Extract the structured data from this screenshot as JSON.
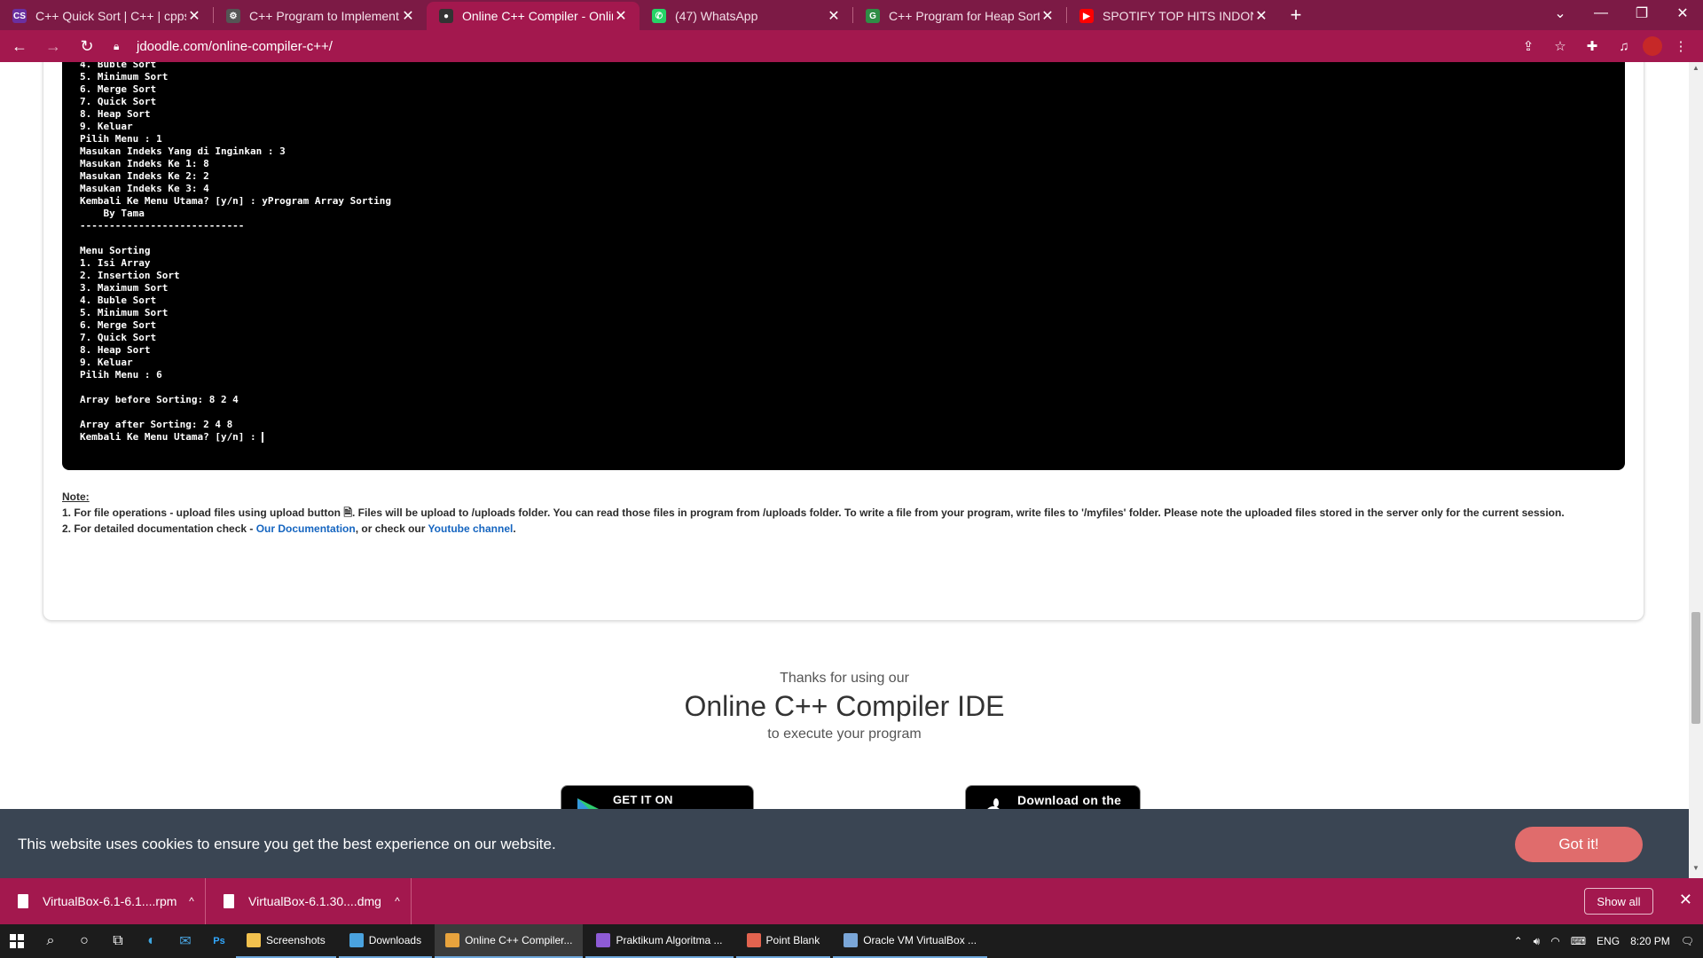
{
  "tabs": [
    {
      "title": "C++ Quick Sort | C++ | cppsecre",
      "favicon": "cppsecrets-icon",
      "color": "#6a2fa0",
      "glyph": "CS"
    },
    {
      "title": "C++ Program to Implement Mer",
      "favicon": "gear-icon",
      "color": "#555555",
      "glyph": "⚙"
    },
    {
      "title": "Online C++ Compiler - Online C",
      "favicon": "jdoodle-icon",
      "color": "#333333",
      "glyph": "●"
    },
    {
      "title": "(47) WhatsApp",
      "favicon": "whatsapp-icon",
      "color": "#25d366",
      "glyph": "✆"
    },
    {
      "title": "C++ Program for Heap Sort - Ge",
      "favicon": "geeksforgeeks-icon",
      "color": "#2f8d46",
      "glyph": "G"
    },
    {
      "title": "SPOTIFY TOP HITS INDONESI",
      "favicon": "youtube-icon",
      "color": "#ff0000",
      "glyph": "▶"
    }
  ],
  "url": "jdoodle.com/online-compiler-c++/",
  "terminal_lines": [
    "4. Buble Sort",
    "5. Minimum Sort",
    "6. Merge Sort",
    "7. Quick Sort",
    "8. Heap Sort",
    "9. Keluar",
    "Pilih Menu : 1",
    "Masukan Indeks Yang di Inginkan : 3",
    "Masukan Indeks Ke 1: 8",
    "Masukan Indeks Ke 2: 2",
    "Masukan Indeks Ke 3: 4",
    "Kembali Ke Menu Utama? [y/n] : yProgram Array Sorting",
    "    By Tama",
    "----------------------------",
    "",
    "Menu Sorting",
    "1. Isi Array",
    "2. Insertion Sort",
    "3. Maximum Sort",
    "4. Buble Sort",
    "5. Minimum Sort",
    "6. Merge Sort",
    "7. Quick Sort",
    "8. Heap Sort",
    "9. Keluar",
    "Pilih Menu : 6",
    "",
    "Array before Sorting: 8 2 4",
    "",
    "Array after Sorting: 2 4 8",
    "Kembali Ke Menu Utama? [y/n] : "
  ],
  "notes": {
    "title": "Note:",
    "line1_a": "1. For file operations - upload files using upload button ",
    "line1_b": ". Files will be upload to /uploads folder. You can read those files in program from /uploads folder. To write a file from your program, write files to '/myfiles' folder. Please note the uploaded files stored in the server only for the current session.",
    "line2_a": "2. For detailed documentation check - ",
    "line2_link1": "Our Documentation",
    "line2_b": ", or check our ",
    "line2_link2": "Youtube channel",
    "line2_c": "."
  },
  "thanks": {
    "small": "Thanks for using our",
    "big": "Online C++ Compiler IDE",
    "sub": "to execute your program"
  },
  "stores": {
    "google": "GET IT ON",
    "apple": "Download on the"
  },
  "cookie": {
    "message": "This website uses cookies to ensure you get the best experience on our website.",
    "button": "Got it!"
  },
  "downloads": [
    {
      "name": "VirtualBox-6.1-6.1....rpm"
    },
    {
      "name": "VirtualBox-6.1.30....dmg"
    }
  ],
  "show_all": "Show all",
  "taskbar_apps": [
    {
      "label": "Screenshots",
      "color": "#f2c14e",
      "active": false
    },
    {
      "label": "Downloads",
      "color": "#4aa3df",
      "active": false
    },
    {
      "label": "Online C++ Compiler...",
      "color": "#e8a33d",
      "active": true
    },
    {
      "label": "Praktikum Algoritma ...",
      "color": "#8e5bd6",
      "active": false
    },
    {
      "label": "Point Blank",
      "color": "#e2634f",
      "active": false
    },
    {
      "label": "Oracle VM VirtualBox ...",
      "color": "#7aa6d8",
      "active": false
    }
  ],
  "tray": {
    "lang": "ENG",
    "time": "8:20 PM"
  }
}
